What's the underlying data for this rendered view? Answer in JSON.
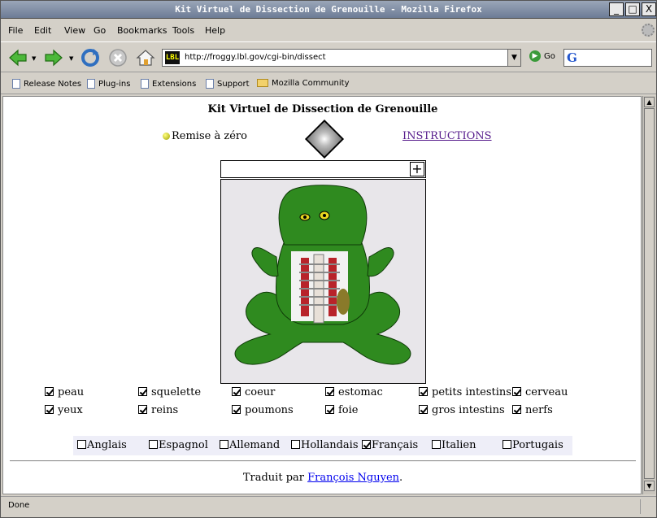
{
  "window": {
    "title": "Kit Virtuel de Dissection de Grenouille - Mozilla Firefox",
    "controls": [
      "_",
      "□",
      "X"
    ]
  },
  "menu": [
    "File",
    "Edit",
    "View",
    "Go",
    "Bookmarks",
    "Tools",
    "Help"
  ],
  "navbar": {
    "favicon_text": "LBL",
    "url": "http://froggy.lbl.gov/cgi-bin/dissect",
    "go_label": "Go",
    "search_engine_icon": "G"
  },
  "bookmarks": [
    {
      "label": "Release Notes",
      "icon": "page-icon"
    },
    {
      "label": "Plug-ins",
      "icon": "page-icon"
    },
    {
      "label": "Extensions",
      "icon": "page-icon"
    },
    {
      "label": "Support",
      "icon": "page-icon"
    },
    {
      "label": "Mozilla Community",
      "icon": "folder-icon"
    }
  ],
  "page": {
    "heading": "Kit Virtuel de Dissection de Grenouille",
    "reset_label": "Remise à zéro",
    "instructions_label": "INSTRUCTIONS",
    "organs": [
      {
        "label": "peau",
        "checked": true
      },
      {
        "label": "squelette",
        "checked": true
      },
      {
        "label": "coeur",
        "checked": true
      },
      {
        "label": "estomac",
        "checked": true
      },
      {
        "label": "petits intestins",
        "checked": true
      },
      {
        "label": "cerveau",
        "checked": true
      },
      {
        "label": "yeux",
        "checked": true
      },
      {
        "label": "reins",
        "checked": true
      },
      {
        "label": "poumons",
        "checked": true
      },
      {
        "label": "foie",
        "checked": true
      },
      {
        "label": "gros intestins",
        "checked": true
      },
      {
        "label": "nerfs",
        "checked": true
      }
    ],
    "languages": [
      {
        "label": "Anglais",
        "checked": false
      },
      {
        "label": "Espagnol",
        "checked": false
      },
      {
        "label": "Allemand",
        "checked": false
      },
      {
        "label": "Hollandais",
        "checked": false
      },
      {
        "label": "Français",
        "checked": true
      },
      {
        "label": "Italien",
        "checked": false
      },
      {
        "label": "Portugais",
        "checked": false
      }
    ],
    "credit_prefix": "Traduit par ",
    "credit_name": "François Nguyen",
    "credit_suffix": "."
  },
  "status": {
    "text": "Done"
  },
  "colors": {
    "link": "#0000ee",
    "visited_link": "#551a8b",
    "frog_green": "#2f8a1f",
    "chrome": "#d4d0c8"
  }
}
